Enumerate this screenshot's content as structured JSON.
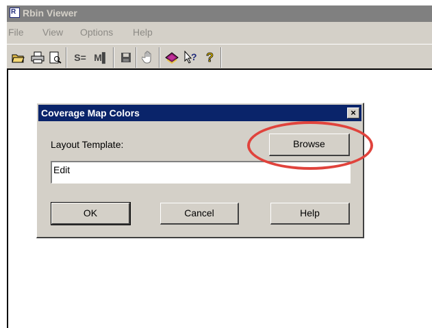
{
  "app": {
    "title": "Rbin Viewer",
    "icon_letter": "R",
    "icon_name": "app-icon"
  },
  "menu": {
    "items": [
      "File",
      "View",
      "Options",
      "Help"
    ]
  },
  "toolbar": {
    "icons": [
      "open-folder-icon",
      "print-icon",
      "print-preview-icon",
      "s-select-icon",
      "m-select-icon",
      "save-disk-icon",
      "hand-pan-icon",
      "book-icon",
      "context-help-icon",
      "help-icon"
    ]
  },
  "dialog": {
    "title": "Coverage Map Colors",
    "close_glyph": "×",
    "field_label": "Layout Template:",
    "field_value": "Edit",
    "browse_label": "Browse",
    "ok_label": "OK",
    "cancel_label": "Cancel",
    "help_label": "Help"
  },
  "annotation": {
    "color": "#e0433c"
  }
}
